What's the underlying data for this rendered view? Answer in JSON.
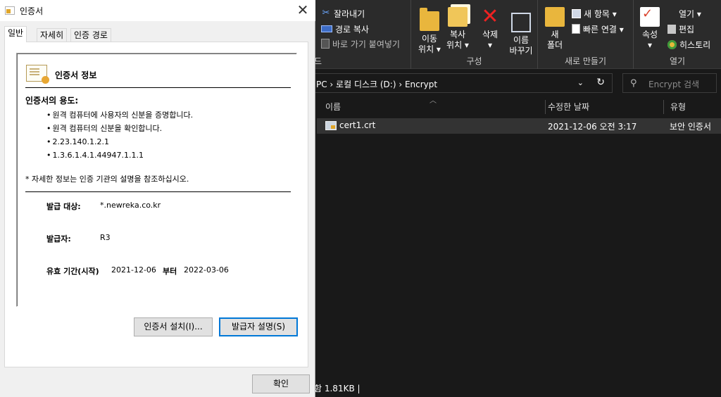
{
  "explorer": {
    "ribbon": {
      "clipboard": {
        "cut": "잘라내기",
        "copy_path": "경로 복사",
        "paste_shortcut": "바로 가기 붙여넣기",
        "group_label": "드"
      },
      "organize": {
        "move_to": [
          "이동",
          "위치 ▾"
        ],
        "copy_to": [
          "복사",
          "위치 ▾"
        ],
        "delete": [
          "삭제",
          "▾"
        ],
        "rename": [
          "이름",
          "바꾸기"
        ],
        "group_label": "구성"
      },
      "new": {
        "new_folder": [
          "새",
          "폴더"
        ],
        "new_item": "새 항목 ▾",
        "easy_access": "빠른 연결 ▾",
        "group_label": "새로 만들기"
      },
      "open": {
        "properties": [
          "속성",
          "▾"
        ],
        "open": "열기 ▾",
        "edit": "편집",
        "history": "히스토리",
        "group_label": "열기"
      }
    },
    "address": {
      "path": "PC  ›  로컬 디스크 (D:)  ›  Encrypt",
      "chevron": "⌄",
      "refresh": "↻"
    },
    "search": {
      "placeholder": "Encrypt 검색"
    },
    "columns": {
      "name": "이름",
      "modified": "수정한 날짜",
      "type": "유형"
    },
    "files": [
      {
        "name": "cert1.crt",
        "modified": "2021-12-06 오전 3:17",
        "type": "보안 인증서"
      }
    ],
    "status": "함 1.81KB  |"
  },
  "dialog": {
    "title": "인증서",
    "close": "✕",
    "tabs": [
      "일반",
      "자세히",
      "인증 경로"
    ],
    "info_heading": "인증서 정보",
    "purposes_title": "인증서의 용도:",
    "purposes": [
      "원격 컴퓨터에 사용자의 신분을 증명합니다.",
      "원격 컴퓨터의 신분을 확인합니다.",
      "2.23.140.1.2.1",
      "1.3.6.1.4.1.44947.1.1.1"
    ],
    "note": "* 자세한 정보는 인증 기관의 설명을 참조하십시오.",
    "issued_to_label": "발급 대상:",
    "issued_to": "*.newreka.co.kr",
    "issued_by_label": "발급자:",
    "issued_by": "R3",
    "validity_label": "유효 기간(시작)",
    "valid_from": "2021-12-06",
    "validity_to_label": "부터",
    "valid_to": "2022-03-06",
    "install_button": "인증서 설치(I)...",
    "issuer_statement_button": "발급자 설명(S)",
    "ok_button": "확인"
  }
}
